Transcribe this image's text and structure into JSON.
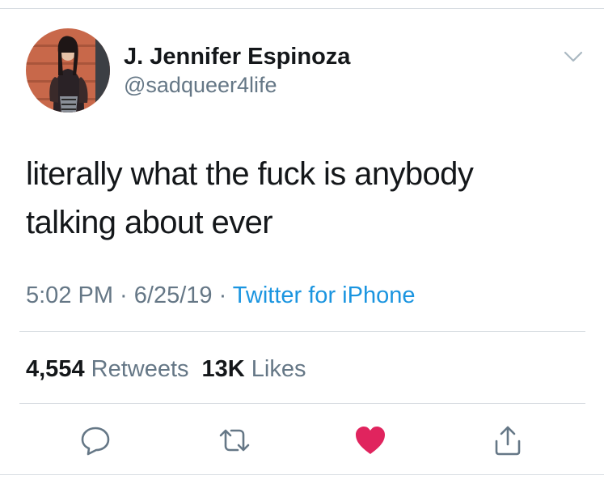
{
  "tweet": {
    "author": {
      "display_name": "J. Jennifer Espinoza",
      "handle": "@sadqueer4life",
      "avatar_icon": "profile-photo"
    },
    "text_lines": [
      "literally what the fuck is anybody",
      "talking about ever"
    ],
    "time": "5:02 PM",
    "date": "6/25/19",
    "separator": " · ",
    "source": "Twitter for iPhone",
    "retweets_count": "4,554",
    "retweets_label": "Retweets",
    "likes_count": "13K",
    "likes_label": "Likes",
    "more_menu_icon": "chevron-down-icon"
  },
  "actions": [
    {
      "icon": "reply-icon"
    },
    {
      "icon": "retweet-icon"
    },
    {
      "icon": "heart-icon",
      "liked": true
    },
    {
      "icon": "share-icon"
    }
  ],
  "colors": {
    "text": "#14171a",
    "secondary": "#657786",
    "link": "#1b95e0",
    "like": "#e0245e",
    "divider": "#d8dde2"
  }
}
